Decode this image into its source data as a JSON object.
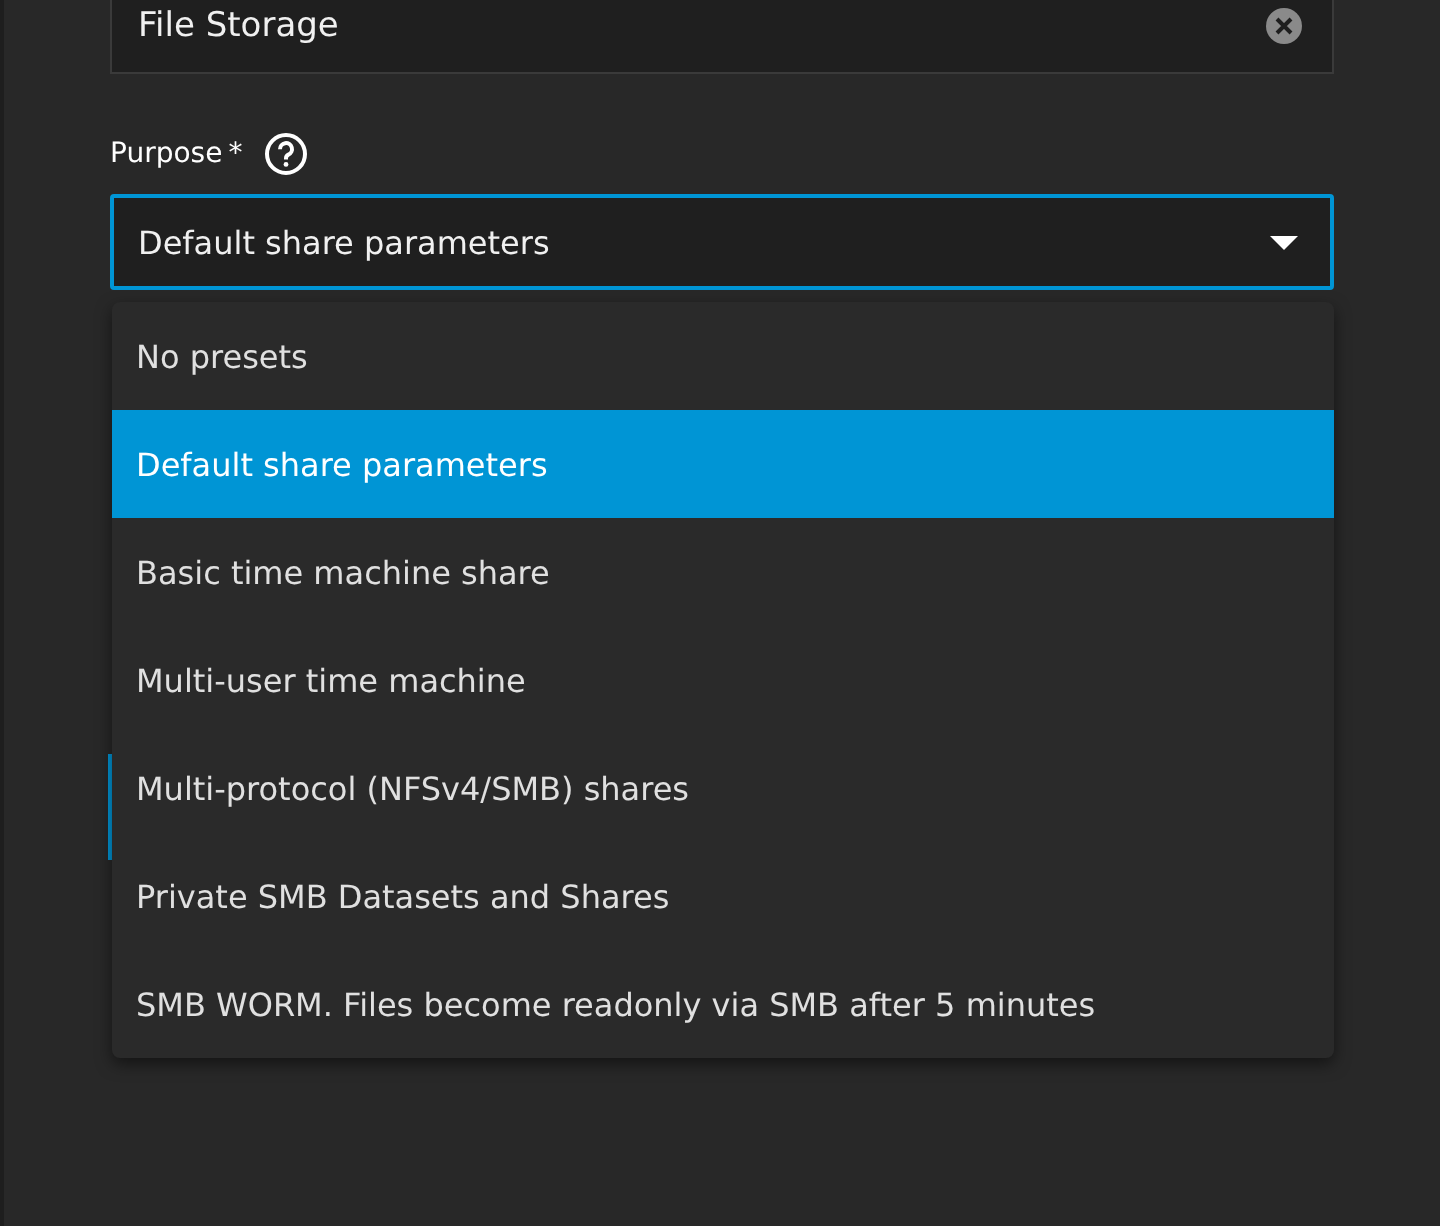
{
  "name_field": {
    "value": "File Storage"
  },
  "purpose": {
    "label": "Purpose",
    "required_mark": "*",
    "value": "Default share parameters"
  },
  "options": [
    {
      "label": "No presets",
      "selected": false
    },
    {
      "label": "Default share parameters",
      "selected": true
    },
    {
      "label": "Basic time machine share",
      "selected": false
    },
    {
      "label": "Multi-user time machine",
      "selected": false
    },
    {
      "label": "Multi-protocol (NFSv4/SMB) shares",
      "selected": false
    },
    {
      "label": "Private SMB Datasets and Shares",
      "selected": false
    },
    {
      "label": "SMB WORM. Files become readonly via SMB after 5 minutes",
      "selected": false
    }
  ]
}
